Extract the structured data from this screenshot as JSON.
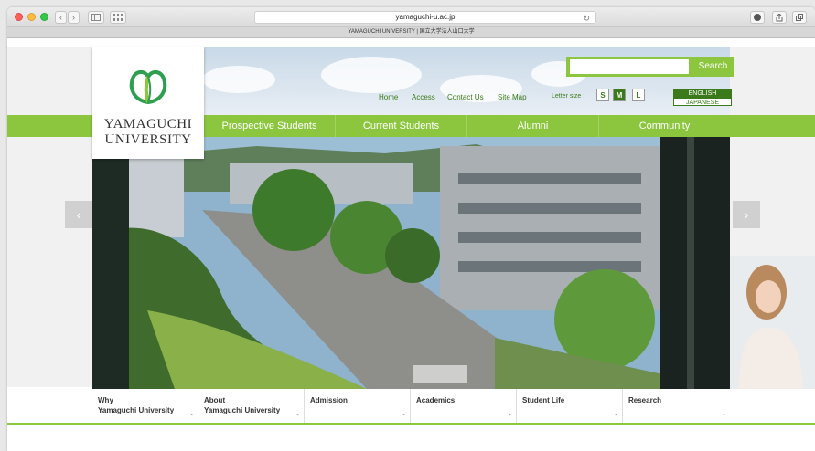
{
  "browser": {
    "url": "yamaguchi-u.ac.jp",
    "tab_title": "YAMAGUCHI UNIVERSITY | 国立大学法人山口大学",
    "back_icon": "‹",
    "forward_icon": "›",
    "reload_icon": "↻"
  },
  "header": {
    "logo_text_line1": "YAMAGUCHI",
    "logo_text_line2": "UNIVERSITY",
    "search_placeholder": "",
    "search_label": "Search",
    "util_links": [
      "Home",
      "Access",
      "Contact Us",
      "Site Map"
    ],
    "letter_size_label": "Letter size :",
    "letter_sizes": [
      "S",
      "M",
      "L"
    ],
    "languages": [
      "ENGLISH",
      "JAPANESE"
    ]
  },
  "nav": {
    "items": [
      "Prospective Students",
      "Current Students",
      "Alumni",
      "Community"
    ]
  },
  "bottom_menu": {
    "items": [
      {
        "line1": "Why",
        "line2": "Yamaguchi University"
      },
      {
        "line1": "About",
        "line2": "Yamaguchi University"
      },
      {
        "line1": "Admission",
        "line2": ""
      },
      {
        "line1": "Academics",
        "line2": ""
      },
      {
        "line1": "Student Life",
        "line2": ""
      },
      {
        "line1": "Research",
        "line2": ""
      }
    ]
  },
  "colors": {
    "accent_green": "#8cc63f",
    "dark_green": "#3b7a1a",
    "logo_green": "#2e9e4f"
  }
}
